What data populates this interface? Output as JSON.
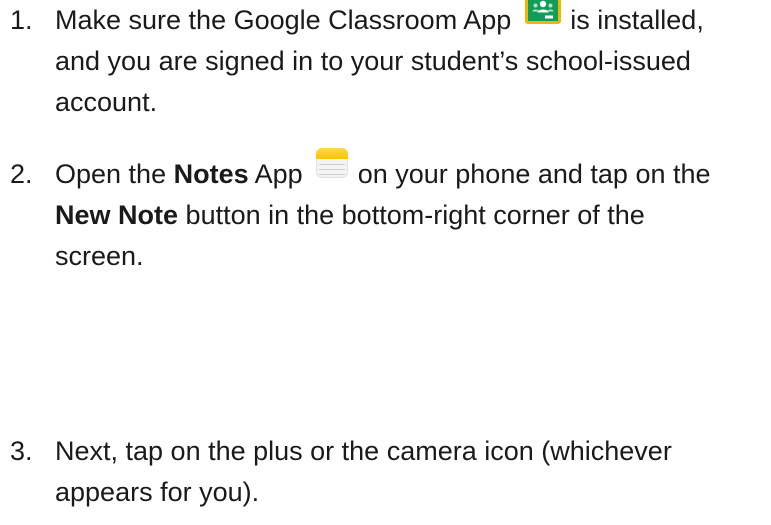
{
  "steps": [
    {
      "number": "1.",
      "line1_before": "Make sure the Google Classroom App",
      "line1_after": "is installed,",
      "line2": "and you are signed in to your student’s school-issued",
      "line3": "account.",
      "icon": "google-classroom-icon"
    },
    {
      "number": "2.",
      "line1_prefix": "Open the",
      "line1_bold": "Notes",
      "line1_mid": "App",
      "line1_after": "on your phone and tap on the",
      "line2_bold": "New Note",
      "line2_rest": "button in the bottom-right corner of the",
      "line3": "screen.",
      "icon": "notes-app-icon"
    },
    {
      "number": "3.",
      "line1": "Next, tap on the plus or the camera icon (whichever",
      "line2": "appears for you)."
    }
  ],
  "colors": {
    "text": "#1a1a1a",
    "classroom_green": "#0f9d58",
    "classroom_yellow": "#f4b400",
    "notes_yellow": "#ffc400"
  }
}
